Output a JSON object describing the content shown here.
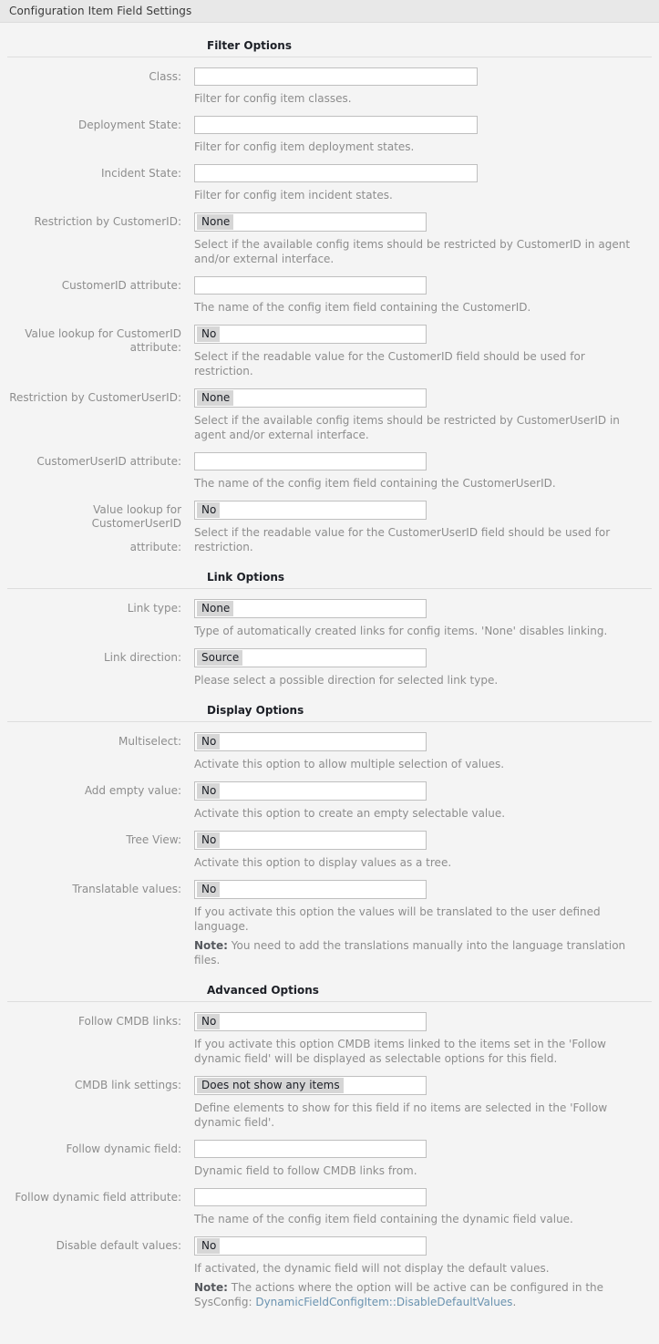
{
  "window": {
    "title": "Configuration Item Field Settings"
  },
  "sections": [
    {
      "title": "Filter Options",
      "rows": [
        {
          "label": "Class:",
          "control": "text-wide",
          "value": "",
          "hint": "Filter for config item classes."
        },
        {
          "label": "Deployment State:",
          "control": "text-wide",
          "value": "",
          "hint": "Filter for config item deployment states."
        },
        {
          "label": "Incident State:",
          "control": "text-wide",
          "value": "",
          "hint": "Filter for config item incident states."
        },
        {
          "label": "Restriction by CustomerID:",
          "control": "listbox",
          "value": "None",
          "hint": "Select if the available config items should be restricted by CustomerID in agent and/or external interface."
        },
        {
          "label": "CustomerID attribute:",
          "control": "text-std",
          "value": "",
          "hint": "The name of the config item field containing the CustomerID."
        },
        {
          "label": "Value lookup for CustomerID attribute:",
          "control": "listbox",
          "value": "No",
          "hint": "Select if the readable value for the CustomerID field should be used for restriction."
        },
        {
          "label": "Restriction by CustomerUserID:",
          "control": "listbox",
          "value": "None",
          "hint": "Select if the available config items should be restricted by CustomerUserID in agent and/or external interface."
        },
        {
          "label": "CustomerUserID attribute:",
          "control": "text-std",
          "value": "",
          "hint": "The name of the config item field containing the CustomerUserID."
        },
        {
          "label_line1": "Value lookup for CustomerUserID",
          "label_line2": "attribute:",
          "control": "listbox",
          "value": "No",
          "hint": "Select if the readable value for the CustomerUserID field should be used for restriction."
        }
      ]
    },
    {
      "title": "Link Options",
      "rows": [
        {
          "label": "Link type:",
          "control": "listbox",
          "value": "None",
          "hint": "Type of automatically created links for config items. 'None' disables linking."
        },
        {
          "label": "Link direction:",
          "control": "listbox",
          "value": "Source",
          "hint": "Please select a possible direction for selected link type."
        }
      ]
    },
    {
      "title": "Display Options",
      "rows": [
        {
          "label": "Multiselect:",
          "control": "listbox",
          "value": "No",
          "hint": "Activate this option to allow multiple selection of values."
        },
        {
          "label": "Add empty value:",
          "control": "listbox",
          "value": "No",
          "hint": "Activate this option to create an empty selectable value."
        },
        {
          "label": "Tree View:",
          "control": "listbox",
          "value": "No",
          "hint": "Activate this option to display values as a tree."
        },
        {
          "label": "Translatable values:",
          "control": "listbox",
          "value": "No",
          "hint": "If you activate this option the values will be translated to the user defined language.",
          "note_label": "Note:",
          "note_text": " You need to add the translations manually into the language translation files."
        }
      ]
    },
    {
      "title": "Advanced Options",
      "rows": [
        {
          "label": "Follow CMDB links:",
          "control": "listbox",
          "value": "No",
          "hint": "If you activate this option CMDB items linked to the items set in the 'Follow dynamic field' will be displayed as selectable options for this field."
        },
        {
          "label": "CMDB link settings:",
          "control": "listbox",
          "value": "Does not show any items",
          "hint": "Define elements to show for this field if no items are selected in the 'Follow dynamic field'."
        },
        {
          "label": "Follow dynamic field:",
          "control": "text-std",
          "value": "",
          "hint": "Dynamic field to follow CMDB links from."
        },
        {
          "label": "Follow dynamic field attribute:",
          "control": "text-std",
          "value": "",
          "hint": "The name of the config item field containing the dynamic field value."
        },
        {
          "label": "Disable default values:",
          "control": "listbox",
          "value": "No",
          "hint": "If activated, the dynamic field will not display the default values.",
          "note_label": "Note:",
          "note_text": " The actions where the option will be active can be configured in the SysConfig: ",
          "note_link": "DynamicFieldConfigItem::DisableDefaultValues",
          "note_tail": "."
        }
      ]
    }
  ],
  "colors": {
    "titlebar_bg": "#e8e8e8",
    "page_bg": "#f4f4f4",
    "label": "#8d8d8d",
    "heading": "#1c1f26",
    "link": "#6a93b0",
    "option_highlight": "#d6d6d6",
    "input_border": "#bfbfbf",
    "divider": "#dddddd"
  }
}
